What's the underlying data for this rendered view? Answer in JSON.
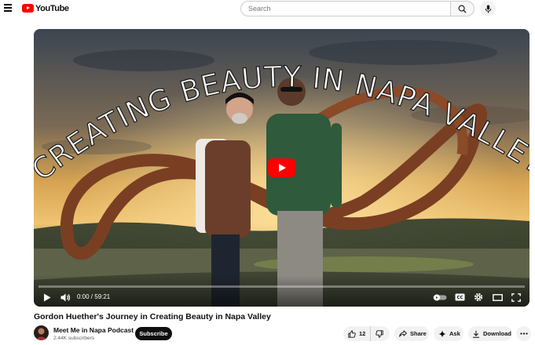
{
  "header": {
    "logo_text": "YouTube",
    "search_placeholder": "Search"
  },
  "player": {
    "overlay_title": "CREATING BEAUTY IN NAPA VALLEY",
    "time_display": "0:00 / 59:21",
    "progress_fraction": 0.0
  },
  "video": {
    "title": "Gordon Huether's Journey in Creating Beauty in Napa Valley"
  },
  "channel": {
    "name": "Meet Me in Napa Podcast",
    "subscribers": "2.44K subscribers",
    "subscribe_label": "Subscribe"
  },
  "actions": {
    "like_count": "12",
    "share_label": "Share",
    "ask_label": "Ask",
    "download_label": "Download"
  },
  "colors": {
    "brand_red": "#ff0000",
    "subscribe_bg": "#0f0f0f",
    "pill_bg": "#f2f2f2"
  },
  "icons": [
    "menu-icon",
    "youtube-logo",
    "search-icon",
    "microphone-icon",
    "play-icon",
    "volume-icon",
    "autoplay-toggle",
    "captions-icon",
    "settings-icon",
    "theater-icon",
    "fullscreen-icon",
    "thumbs-up-icon",
    "thumbs-down-icon",
    "share-icon",
    "sparkle-icon",
    "download-icon",
    "more-icon"
  ]
}
